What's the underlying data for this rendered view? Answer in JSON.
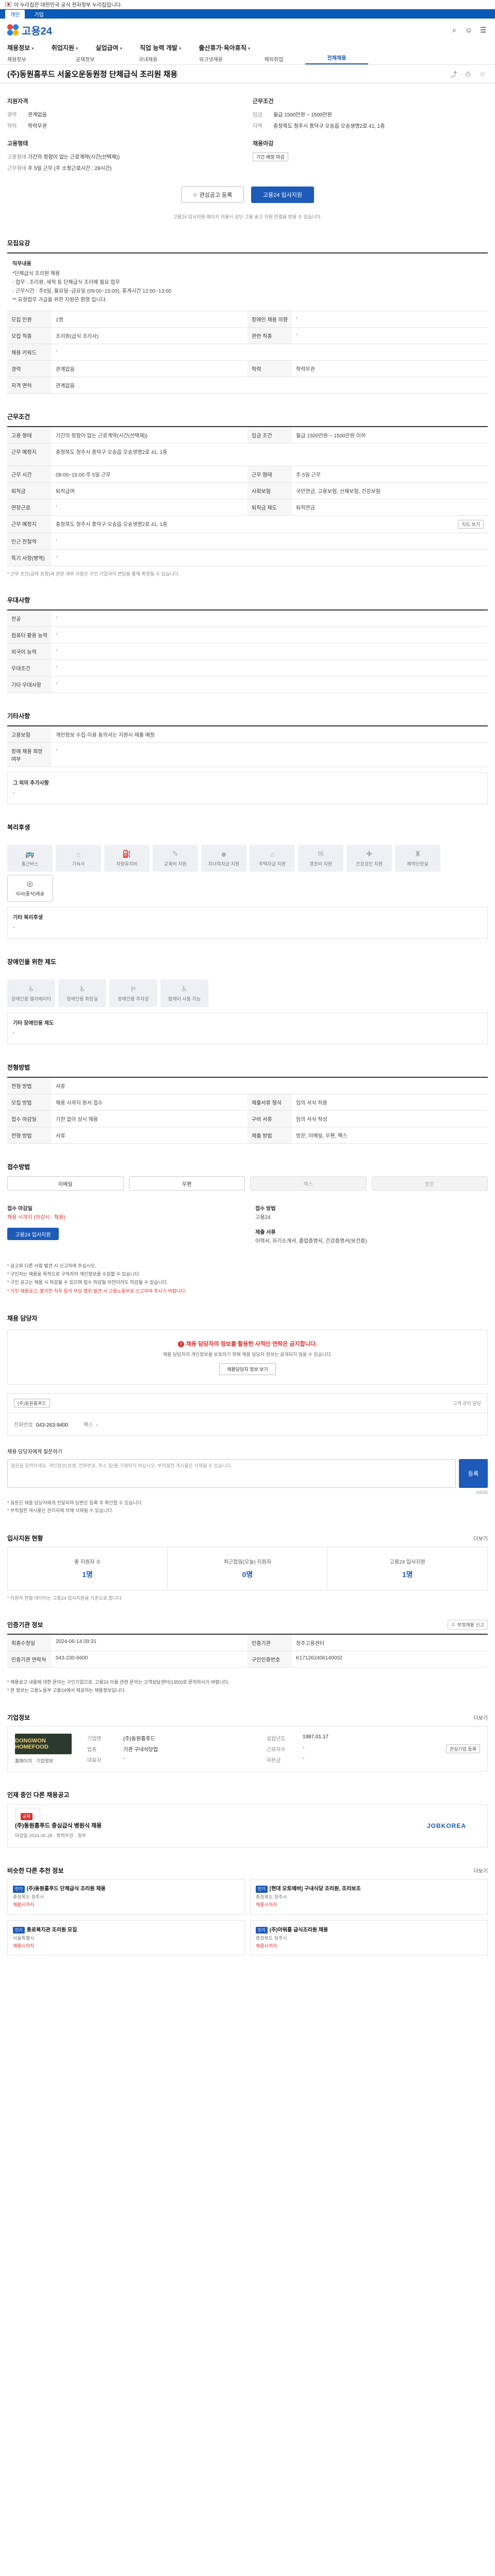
{
  "gov": {
    "text": "이 누리집은 대한민국 공식 전자정부 누리집입니다."
  },
  "topnav": {
    "items": [
      "개인",
      "기업"
    ]
  },
  "logo": {
    "text": "고용24"
  },
  "gnb": {
    "items": [
      "채용정보",
      "취업지원",
      "실업급여",
      "직업 능력 개발",
      "출산휴가·육아휴직"
    ]
  },
  "subnav": {
    "items": [
      "채용정보",
      "공채정보",
      "국내채용",
      "워크넷채용",
      "해외취업",
      "전체채용"
    ]
  },
  "title": "(주)동원홈푸드 서울오운동원정 단체급식 조리원 채용",
  "summary": {
    "left_title": "지원자격",
    "left_rows": [
      {
        "k": "경력",
        "v": "관계없음"
      },
      {
        "k": "학력",
        "v": "학력무관"
      }
    ],
    "left_title2": "고용형태",
    "left_rows2": [
      {
        "k": "고용형태",
        "v": "기간의 정함이 없는 근로계약(시간(선택제))"
      },
      {
        "k": "근무형태",
        "v": "주 5일 근무 (주 소정근로시간 : 28시간)"
      }
    ],
    "right_title": "근무조건",
    "right_rows": [
      {
        "k": "임금",
        "v": "월급 1500만원 ~ 1500만원"
      },
      {
        "k": "지역",
        "v": "충청북도 청주시 흥덕구 오송읍 오송생명2로 41, 1층"
      }
    ],
    "right_title2": "채용마감",
    "right_rows2": [
      {
        "k": "",
        "v": "기간 배정 마감"
      }
    ]
  },
  "buttons": {
    "interest": "관심공고 등록",
    "apply": "고용24 입사지원"
  },
  "notice_center": "고용24 입사지원 페이지 이용시 상단 고용 공고 지원 연결을 받을 수 있습니다.",
  "recruit": {
    "title": "모집요강",
    "jobdesc_title": "직무내용",
    "jobdesc": [
      "*단체급식 조리원 채용",
      "- 업무 : 조리원, 세척 등 단체급식 조리에 필요 업무",
      "- 근무시간 : 주5일, 월요일~금요일 (09:00~15:00), 휴게시간 12:00~13:00",
      "** 요청업무 가급을 위한 지원은 환영 입니다."
    ],
    "rows": [
      {
        "k1": "모집 인원",
        "v1": "1명",
        "k2": "장애인 채용 의향",
        "v2": "-"
      },
      {
        "k1": "모집 직종",
        "v1": "조리원(급식 조리사)",
        "k2": "관련 직종",
        "v2": "-"
      },
      {
        "k1": "채용 키워드",
        "v1": "-",
        "k2": "",
        "v2": ""
      },
      {
        "k1": "경력",
        "v1": "관계없음",
        "k2": "학력",
        "v2": "학력무관"
      },
      {
        "k1": "자격 면허",
        "v1": "관계없음",
        "k2": "",
        "v2": ""
      }
    ]
  },
  "conditions": {
    "title": "근무조건",
    "rows": [
      {
        "k1": "고용 형태",
        "v1": "기간의 정함이 없는 근로계약(시간(선택제))",
        "k2": "임금 조건",
        "v2": "월급 1500만원 ~ 1500만원 이하"
      },
      {
        "k1": "근무 예정지",
        "v1": "충청북도 청주시 흥덕구 오송읍 오송생명2로 41, 1층",
        "k2": "",
        "v2": ""
      },
      {
        "k1": "근무 시간",
        "v1": "09:00~15:00 주 5일 근무",
        "k2": "근무 형태",
        "v2": "주 5일 근무"
      },
      {
        "k1": "퇴직금",
        "v1": "퇴직급여",
        "k2": "사회보험",
        "v2": "국민연금, 고용보험, 산재보험, 건강보험"
      },
      {
        "k1": "연장근로",
        "v1": "-",
        "k2": "퇴직금 제도",
        "v2": "퇴직연금"
      },
      {
        "k1": "근무 예정지",
        "v1": "충청북도 청주시 흥덕구 오송읍 오송생명2로 41, 1층",
        "k2": "",
        "v2": ""
      },
      {
        "k1": "인근 전철역",
        "v1": "-",
        "k2": "",
        "v2": ""
      },
      {
        "k1": "특기 사항(병역)",
        "v1": "-",
        "k2": "",
        "v2": ""
      }
    ],
    "map_button": "지도 보기",
    "footnote": "* 근무 조건(급여 포함)과 관련 세부 사항은 구인 기업과의 면담을 통해 확정될 수 있습니다."
  },
  "preference": {
    "title": "우대사항",
    "rows": [
      {
        "k": "전공",
        "v": "-"
      },
      {
        "k": "컴퓨터 활용 능력",
        "v": "-"
      },
      {
        "k": "외국어 능력",
        "v": "-"
      },
      {
        "k": "우대조건",
        "v": "-"
      },
      {
        "k": "기타 우대사항",
        "v": "-"
      }
    ]
  },
  "etc": {
    "title": "기타사항",
    "rows": [
      {
        "k": "고용보험",
        "v": "개인정보 수집·이용 동의서는 지원시 제출 예정"
      },
      {
        "k": "장애 채용 희망 여부",
        "v": "-"
      }
    ],
    "more_title": "그 외의 추가사항",
    "more_value": "-"
  },
  "welfare": {
    "title": "복리후생",
    "cards": [
      {
        "icon": "car-icon",
        "label": "통근버스"
      },
      {
        "icon": "home-icon",
        "label": "기숙사"
      },
      {
        "icon": "meal-icon",
        "label": "차량유지비"
      },
      {
        "icon": "book-icon",
        "label": "교육비 지원"
      },
      {
        "icon": "child-icon",
        "label": "자녀학자금 지원"
      },
      {
        "icon": "house-icon",
        "label": "주택자금 지원"
      },
      {
        "icon": "gift-icon",
        "label": "경조비 지원"
      },
      {
        "icon": "clinic-icon",
        "label": "건강검진 지원"
      },
      {
        "icon": "gym-icon",
        "label": "체력단련실"
      },
      {
        "icon": "lunch-icon",
        "label": "식사(중식)제공"
      }
    ],
    "active_index": 9,
    "etc_title": "기타 복리후생",
    "etc_value": "-"
  },
  "disability": {
    "title": "장애인을 위한 제도",
    "cards": [
      {
        "icon": "wheelchair-icon",
        "label": "장애인용 엘리베이터"
      },
      {
        "icon": "toilet-icon",
        "label": "장애인용 화장실"
      },
      {
        "icon": "parking-icon",
        "label": "장애인용 주차장"
      },
      {
        "icon": "ramp-icon",
        "label": "휠체어 사용 가능"
      }
    ],
    "etc_title": "기타 장애인용 제도",
    "etc_value": "-"
  },
  "screening": {
    "title": "전형방법",
    "rows": [
      {
        "k1": "전형 방법",
        "v1": "서류",
        "k2": "",
        "v2": ""
      },
      {
        "k1": "모집 방법",
        "v1": "채용 시까지 원서 접수",
        "k2": "제출서류 형식",
        "v2": "임의 서식 허용"
      },
      {
        "k1": "접수 마감일",
        "v1": "기한 없이 상시 채용",
        "k2": "구비 서류",
        "v2": "임의 서식 작성"
      },
      {
        "k1": "전형 방법",
        "v1": "서류",
        "k2": "제출 방법",
        "v2": "방문, 이메일, 우편, 팩스"
      }
    ]
  },
  "apply": {
    "title": "접수방법",
    "methods": [
      "이메일",
      "우편",
      "팩스",
      "방문"
    ],
    "disabled": [
      2,
      3
    ],
    "period_label": "접수 마감일",
    "period_value": "채용 시까지 (마감시 : 채용)",
    "method_label": "접수 방법",
    "method_value": "고용24",
    "btn": "고용24 입사지원",
    "docs_label": "제출 서류",
    "docs_value": "이력서, 자기소개서, 졸업증명서, 건강증명서(보건증)",
    "bullets": [
      "* 공고와 다른 사항 발견 시 신고하여 주십시오.",
      "* 구인자는 채용을 목적으로 구직자의 개인정보를 수집할 수 있습니다.",
      "* 구인 공고는 채용 시 마감될 수 있으며 접수 마감일 이전이라도 마감될 수 있습니다.",
      "* 거짓 채용공고, 불리한 처우 등의 부당 행위 발견 시 고용노동부로 신고하여 주시기 바랍니다."
    ]
  },
  "manager": {
    "title": "채용 담당자",
    "warn": "채용 담당자의 정보를 활용한 사적인 연락은 금지합니다.",
    "desc": "채용 담당자의 개인정보를 보호하기 위해 채용 담당자 정보는 공개되지 않을 수 있습니다.",
    "btn": "채용담당자 정보 보기",
    "company": "(주)동원홈푸드",
    "meta": "고객 관리 담당",
    "phone_label": "전화번호",
    "phone_value": "043-263-9400",
    "fax_label": "팩스",
    "fax_value": "-"
  },
  "qa": {
    "title": "채용 담당자에게 질문하기",
    "limit": "0/500",
    "placeholder": "질문을 입력하세요. 개인정보(성명, 전화번호, 주소 등)를 기재하지 마십시오. 부적절한 게시물은 삭제될 수 있습니다.",
    "btn": "등록",
    "notes": [
      "* 질문은 채용 담당자에게 전달되며 답변은 등록 후 확인할 수 있습니다.",
      "* 부적절한 게시물은 관리자에 의해 삭제될 수 있습니다."
    ]
  },
  "stats": {
    "title": "입사지원 현황",
    "more": "더보기",
    "items": [
      {
        "label": "총 지원자 수",
        "value": "1명"
      },
      {
        "label": "최근접일(오늘) 지원자",
        "value": "0명"
      },
      {
        "label": "고용24 입사지원",
        "value": "1명"
      }
    ],
    "note": "* 지원자 현황 데이터는 고용24 입사지원을 기준으로 합니다."
  },
  "reg": {
    "title": "인증기관 정보",
    "flag": "부정채용 신고",
    "rows": [
      {
        "k1": "최종수정일",
        "v1": "2024-06-14 09:31",
        "k2": "인증기관",
        "v2": "청주고용센터"
      },
      {
        "k1": "인증기관 연락처",
        "v1": "043-230-6600",
        "k2": "구인인증번호",
        "v2": "K171262406140002"
      }
    ],
    "notes": [
      "* 채용공고 내용에 대한 문의는 구인기업으로, 고용24 이용 관련 문의는 고객상담센터(1350)로 문의하시기 바랍니다.",
      "* 본 정보는 고용노동부 고용24에서 제공하는 채용정보입니다."
    ]
  },
  "company": {
    "title": "기업정보",
    "more": "더보기",
    "logo": "DONGWON HOMEFOOD",
    "rows": [
      {
        "k": "기업명",
        "v": "(주)동원홈푸드"
      },
      {
        "k": "업종",
        "v": "기관 구내식당업"
      },
      {
        "k": "대표자",
        "v": "-"
      },
      {
        "k": "설립년도",
        "v": "1997.01.17"
      },
      {
        "k": "근로자수",
        "v": "-"
      },
      {
        "k": "자본금",
        "v": "-"
      }
    ],
    "links": [
      "홈페이지",
      "기업정보"
    ],
    "btn": "관심기업 등록"
  },
  "otherjob": {
    "title": "인재 중인 다른 채용공고",
    "tag": "공채",
    "name": "(주)동원홈푸드 중심급식 병원식 채용",
    "meta": [
      "마감일 2024.06.28",
      "학력무관",
      "청주"
    ],
    "brand": "JOBKOREA"
  },
  "recommend": {
    "title": "비슷한 다른 추천 정보",
    "more": "더보기",
    "cards": [
      {
        "tag": "인기",
        "title": "(주)동원홈푸드 단체급식 조리원 채용",
        "meta": "충청북도 청주시",
        "dd": "채용시까지"
      },
      {
        "tag": "인기",
        "title": "[현대 오토에버] 구내식당 조리원, 조리보조",
        "meta": "충청북도 청주시",
        "dd": "채용시까지"
      },
      {
        "tag": "인기",
        "title": "종로복지관 조리원 모집",
        "meta": "서울특별시",
        "dd": "채용시까지"
      },
      {
        "tag": "인기",
        "title": "(주)아워홈 급식조리원 채용",
        "meta": "충청북도 청주시",
        "dd": "채용시까지"
      }
    ]
  },
  "colors": {
    "primary": "#1e5bb8",
    "accent_red": "#d33333"
  }
}
